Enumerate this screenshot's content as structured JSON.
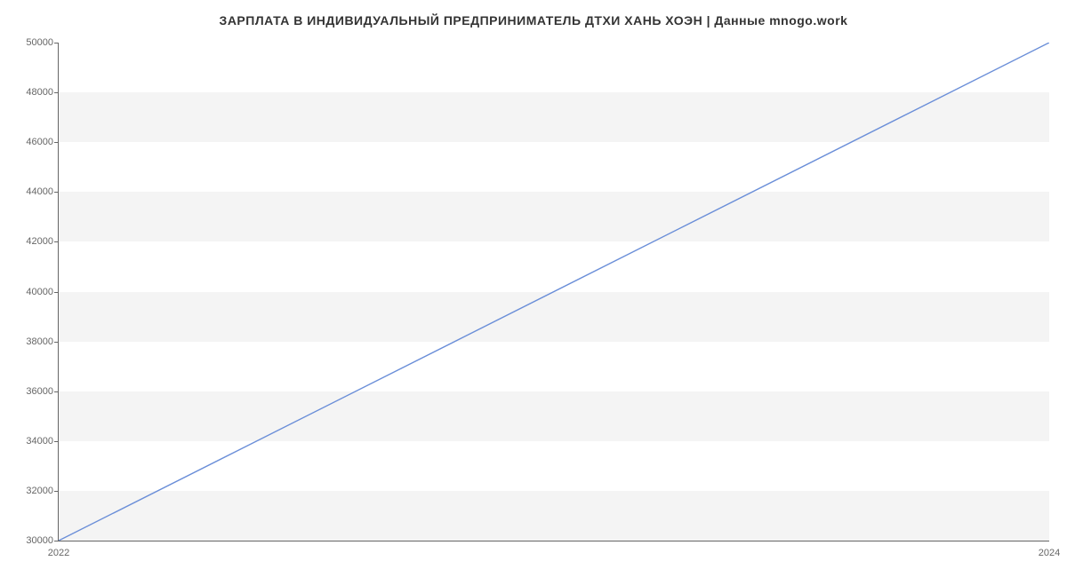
{
  "chart_data": {
    "type": "line",
    "title": "ЗАРПЛАТА В ИНДИВИДУАЛЬНЫЙ ПРЕДПРИНИМАТЕЛЬ ДТХИ ХАНЬ ХОЭН | Данные mnogo.work",
    "x": [
      2022,
      2024
    ],
    "values": [
      30000,
      50000
    ],
    "xlabel": "",
    "ylabel": "",
    "x_ticks": [
      2022,
      2024
    ],
    "y_ticks": [
      30000,
      32000,
      34000,
      36000,
      38000,
      40000,
      42000,
      44000,
      46000,
      48000,
      50000
    ],
    "xlim": [
      2022,
      2024
    ],
    "ylim": [
      30000,
      50000
    ],
    "line_color": "#6a8ed8"
  }
}
